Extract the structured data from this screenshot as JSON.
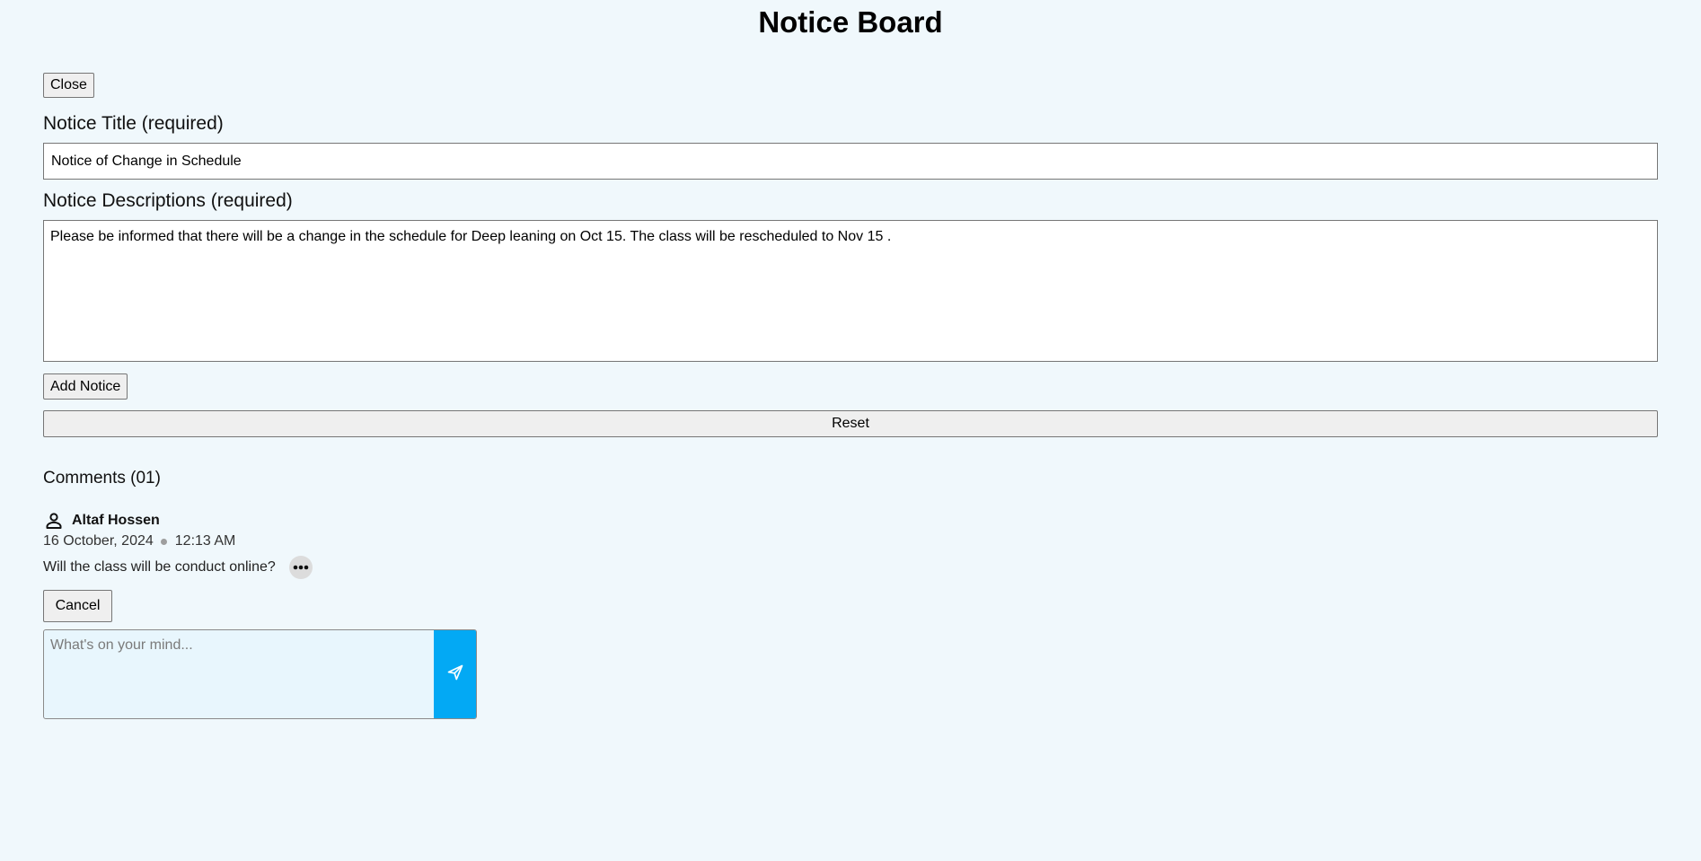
{
  "page": {
    "title": "Notice Board"
  },
  "form": {
    "close_label": "Close",
    "title_label": "Notice Title (required)",
    "title_value": "Notice of Change in Schedule",
    "description_label": "Notice Descriptions (required)",
    "description_value": "Please be informed that there will be a change in the schedule for Deep leaning on Oct 15. The class will be rescheduled to Nov 15 .",
    "add_label": "Add Notice",
    "reset_label": "Reset"
  },
  "comments": {
    "heading": "Comments (01)",
    "items": [
      {
        "author": "Altaf Hossen",
        "date": "16 October, 2024",
        "time": "12:13 AM",
        "text": "Will the class will be conduct online?",
        "avatar_icon": "person-icon",
        "menu_icon": "more-horizontal-icon"
      }
    ],
    "cancel_label": "Cancel",
    "composer_placeholder": "What's on your mind...",
    "send_icon": "send-icon"
  },
  "colors": {
    "background": "#f0f8fc",
    "accent": "#03a9f4",
    "composer_background": "#e8f6fd"
  }
}
